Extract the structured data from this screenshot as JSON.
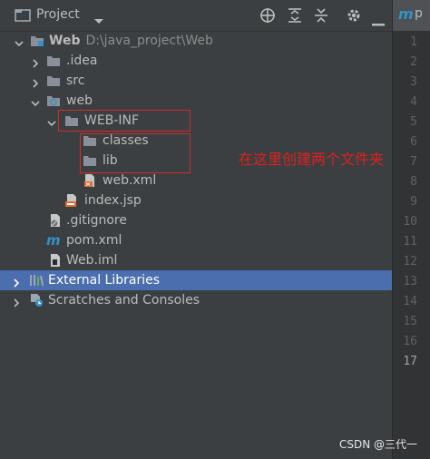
{
  "toolbar": {
    "title": "Project",
    "icons": [
      "project-folder-icon",
      "dropdown-icon",
      "locate-icon",
      "expand-all-icon",
      "collapse-all-icon",
      "gear-icon",
      "hide-icon"
    ]
  },
  "editor_tab": {
    "icon": "m",
    "label": "p"
  },
  "tree": {
    "root": {
      "label": "Web",
      "path": "D:\\java_project\\Web"
    },
    "idea": ".idea",
    "src": "src",
    "web": "web",
    "webinf": "WEB-INF",
    "classes": "classes",
    "lib": "lib",
    "webxml": "web.xml",
    "indexjsp": "index.jsp",
    "gitignore": ".gitignore",
    "pom": "pom.xml",
    "webiml": "Web.iml",
    "extlibs": "External Libraries",
    "scratches": "Scratches and Consoles"
  },
  "gutter": {
    "lines": [
      "1",
      "2",
      "3",
      "4",
      "5",
      "6",
      "7",
      "8",
      "9",
      "10",
      "11",
      "12",
      "13",
      "14",
      "15",
      "16",
      "17"
    ]
  },
  "annotation": "在这里创建两个文件夹",
  "watermark": "CSDN @三代一",
  "colors": {
    "selection": "#4b6eaf",
    "highlight_box": "#d02c2c",
    "annotation_text": "#e0201e",
    "folder": "#8a9099"
  }
}
